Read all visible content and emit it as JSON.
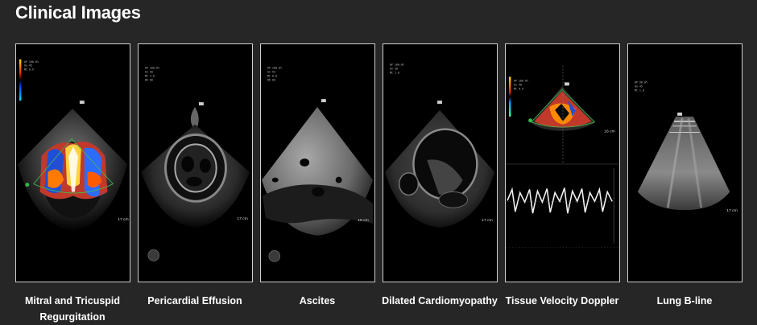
{
  "header": {
    "title": "Clinical Images"
  },
  "images": [
    {
      "caption_line1": "Mitral and Tricuspid",
      "caption_line2": "Regurgitation",
      "depth_label": "17 cm"
    },
    {
      "caption_line1": "Pericardial Effusion",
      "caption_line2": "",
      "depth_label": "17 cm"
    },
    {
      "caption_line1": "Ascites",
      "caption_line2": "",
      "depth_label": "16 cm"
    },
    {
      "caption_line1": "Dilated Cardiomyopathy",
      "caption_line2": "",
      "depth_label": "17 cm"
    },
    {
      "caption_line1": "Tissue Velocity Doppler",
      "caption_line2": "",
      "depth_label": "16 cm"
    },
    {
      "caption_line1": "Lung B-line",
      "caption_line2": "",
      "depth_label": "17 cm"
    }
  ]
}
